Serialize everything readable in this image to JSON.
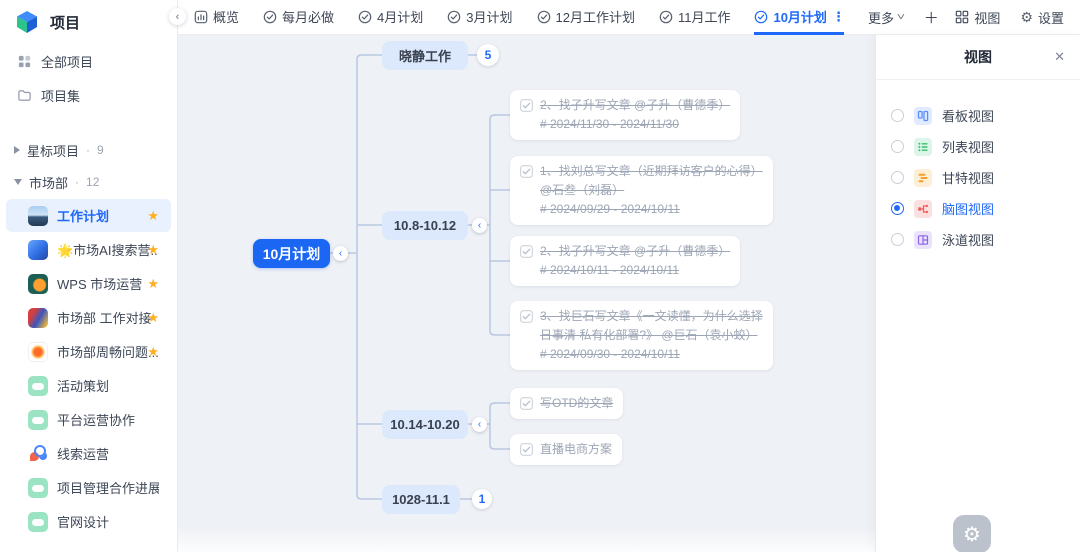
{
  "app": {
    "title": "项目"
  },
  "icons": {
    "chevron_left": "‹",
    "chevron_down": "˅",
    "plus": "＋",
    "close": "✕",
    "star": "★",
    "gear": "⚙",
    "dot": "·",
    "kebab": "⋮"
  },
  "sidebar": {
    "nav": [
      {
        "label": "全部项目"
      },
      {
        "label": "项目集"
      }
    ],
    "groups": [
      {
        "label": "星标项目",
        "count": "9"
      },
      {
        "label": "市场部",
        "count": "12"
      }
    ],
    "projects": [
      {
        "label": "工作计划",
        "starred": true,
        "active": true
      },
      {
        "label": "🌟市场AI搜索营...",
        "starred": true
      },
      {
        "label": "WPS 市场运营",
        "starred": true
      },
      {
        "label": "市场部 工作对接",
        "starred": true
      },
      {
        "label": "市场部周畅问题...",
        "starred": true
      },
      {
        "label": "活动策划",
        "starred": false
      },
      {
        "label": "平台运营协作",
        "starred": false
      },
      {
        "label": "线索运营",
        "starred": false
      },
      {
        "label": "项目管理合作进展",
        "starred": false
      },
      {
        "label": "官网设计",
        "starred": false
      }
    ]
  },
  "tabbar": {
    "tabs": [
      {
        "label": "概览"
      },
      {
        "label": "每月必做"
      },
      {
        "label": "4月计划"
      },
      {
        "label": "3月计划"
      },
      {
        "label": "12月工作计划"
      },
      {
        "label": "11月工作"
      },
      {
        "label": "10月计划",
        "active": true
      }
    ],
    "more_label": "更多",
    "view_label": "视图",
    "settings_label": "设置"
  },
  "mindmap": {
    "root": {
      "label": "10月计划"
    },
    "branches": [
      {
        "label": "晓静工作",
        "badge": "5"
      },
      {
        "label": "10.8-10.12",
        "children": [
          {
            "lines": [
              "2、找子升写文章 @子升（曹德季）",
              "# 2024/11/30 - 2024/11/30"
            ],
            "completed": true
          },
          {
            "lines": [
              "1、找刘总写文章（近期拜访客户的心得）",
              "@石叁（刘磊）",
              "# 2024/09/29 - 2024/10/11"
            ],
            "completed": true
          },
          {
            "lines": [
              "2、找子升写文章 @子升（曹德季）",
              "# 2024/10/11 - 2024/10/11"
            ],
            "completed": true
          },
          {
            "lines": [
              "3、找巨石写文章《一文读懂，为什么选择",
              "日事清 私有化部署?》 @巨石（袁小蛟）",
              "# 2024/09/30 - 2024/10/11"
            ],
            "completed": true
          }
        ]
      },
      {
        "label": "10.14-10.20",
        "children": [
          {
            "lines": [
              "写OTD的文章"
            ],
            "completed": true
          },
          {
            "lines": [
              "直播电商方案"
            ],
            "completed": false
          }
        ]
      },
      {
        "label": "1028-11.1",
        "badge": "1"
      }
    ]
  },
  "view_panel": {
    "title": "视图",
    "options": [
      {
        "label": "看板视图",
        "selected": false
      },
      {
        "label": "列表视图",
        "selected": false
      },
      {
        "label": "甘特视图",
        "selected": false
      },
      {
        "label": "脑图视图",
        "selected": true
      },
      {
        "label": "泳道视图",
        "selected": false
      }
    ]
  }
}
